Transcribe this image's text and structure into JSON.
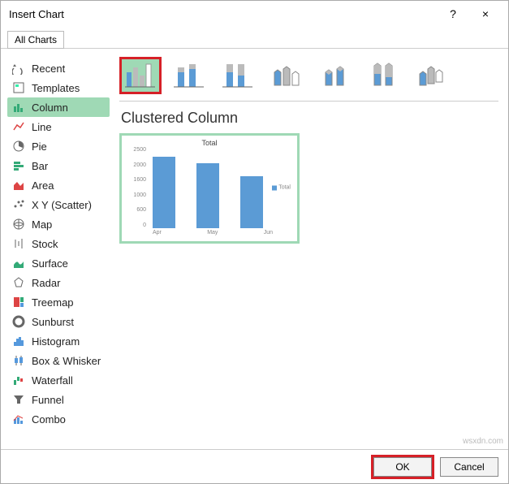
{
  "dialog": {
    "title": "Insert Chart",
    "help": "?",
    "close": "×"
  },
  "tab": "All Charts",
  "sidebar": {
    "items": [
      {
        "label": "Recent"
      },
      {
        "label": "Templates"
      },
      {
        "label": "Column"
      },
      {
        "label": "Line"
      },
      {
        "label": "Pie"
      },
      {
        "label": "Bar"
      },
      {
        "label": "Area"
      },
      {
        "label": "X Y (Scatter)"
      },
      {
        "label": "Map"
      },
      {
        "label": "Stock"
      },
      {
        "label": "Surface"
      },
      {
        "label": "Radar"
      },
      {
        "label": "Treemap"
      },
      {
        "label": "Sunburst"
      },
      {
        "label": "Histogram"
      },
      {
        "label": "Box & Whisker"
      },
      {
        "label": "Waterfall"
      },
      {
        "label": "Funnel"
      },
      {
        "label": "Combo"
      }
    ],
    "selected_index": 2
  },
  "subtype_name": "Clustered Column",
  "preview": {
    "title": "Total",
    "legend": "Total",
    "yticks": [
      "2500",
      "2000",
      "1600",
      "1000",
      "600",
      "0"
    ],
    "xlabels": [
      "Apr",
      "May",
      "Jun"
    ]
  },
  "footer": {
    "ok": "OK",
    "cancel": "Cancel"
  },
  "watermark": "wsxdn.com",
  "chart_data": {
    "type": "bar",
    "title": "Total",
    "categories": [
      "Apr",
      "May",
      "Jun"
    ],
    "series": [
      {
        "name": "Total",
        "values": [
          2200,
          2000,
          1600
        ]
      }
    ],
    "ylabel": "",
    "xlabel": "",
    "ylim": [
      0,
      2500
    ]
  }
}
